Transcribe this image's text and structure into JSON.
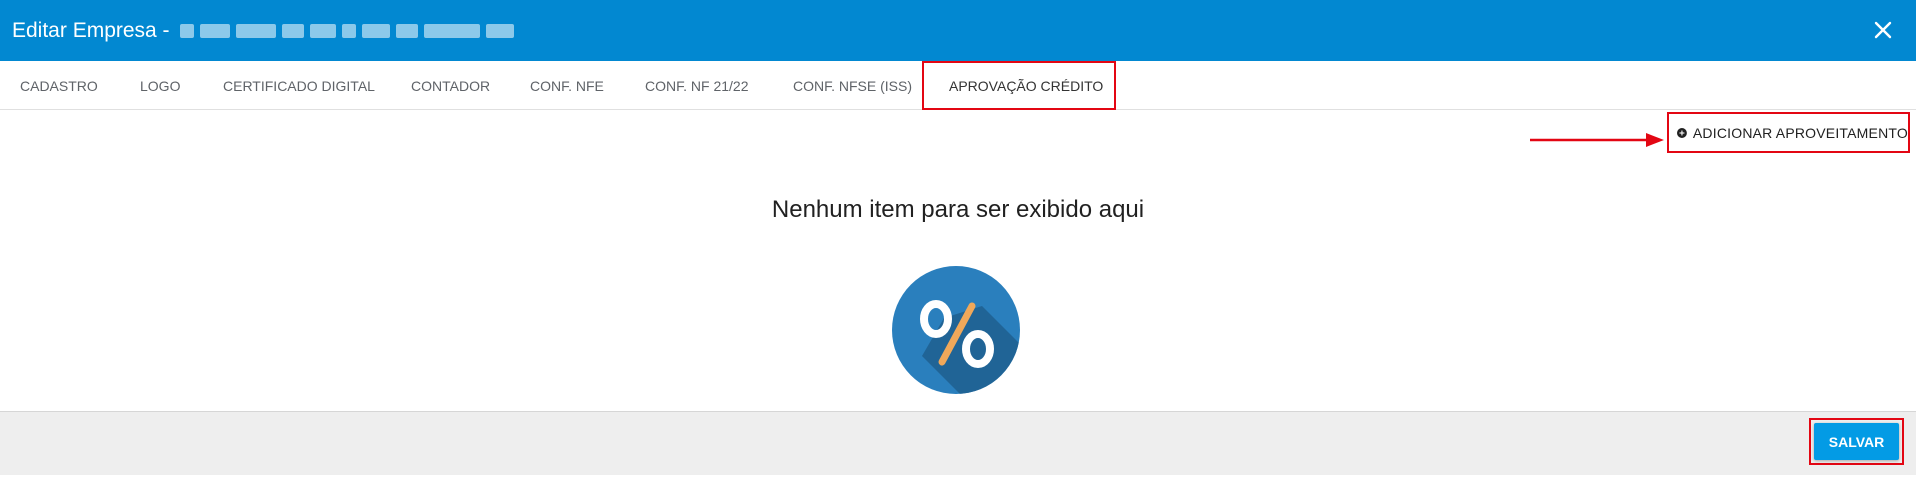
{
  "header": {
    "title": "Editar Empresa -",
    "close_icon": "close-icon",
    "background": "#0288d1"
  },
  "tabs": [
    {
      "label": "CADASTRO"
    },
    {
      "label": "LOGO"
    },
    {
      "label": "CERTIFICADO DIGITAL"
    },
    {
      "label": "CONTADOR"
    },
    {
      "label": "CONF. NFE"
    },
    {
      "label": "CONF. NF 21/22"
    },
    {
      "label": "CONF. NFSE (ISS)"
    },
    {
      "label": "APROVAÇÃO CRÉDITO",
      "active": true
    }
  ],
  "toolbar": {
    "add_label": "ADICIONAR APROVEITAMENTO",
    "add_icon": "plus-circle-icon"
  },
  "empty_state": {
    "message": "Nenhum item para ser exibido aqui",
    "icon": "percent-icon"
  },
  "footer": {
    "save_label": "SALVAR"
  },
  "colors": {
    "accent": "#039be5",
    "highlight": "#e30613"
  }
}
